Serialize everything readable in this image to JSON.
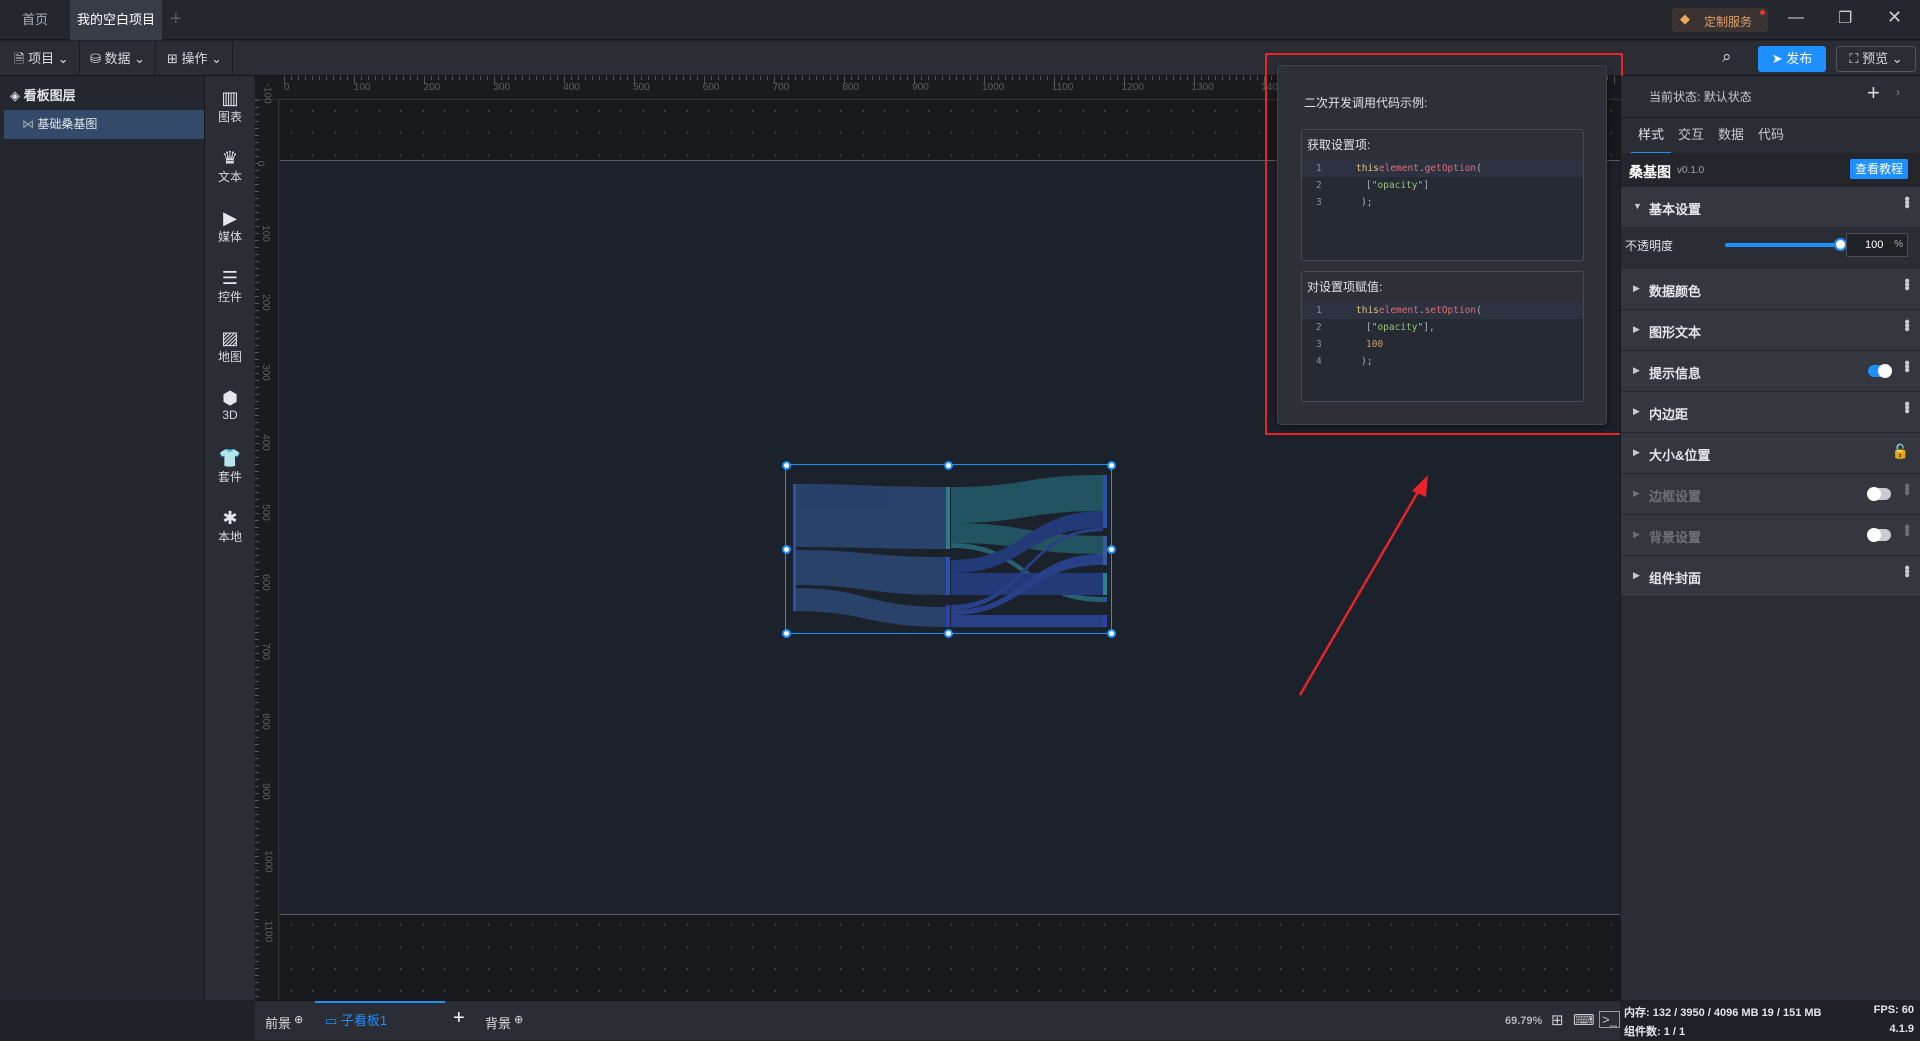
{
  "tabs": [
    {
      "label": "首页"
    },
    {
      "label": "我的空白项目",
      "unsaved": true
    }
  ],
  "titlebar": {
    "service_label": "定制服务"
  },
  "toolbar": {
    "menus": [
      {
        "label": "项目"
      },
      {
        "label": "数据"
      },
      {
        "label": "操作"
      }
    ],
    "publish_label": "发布",
    "preview_label": "预览"
  },
  "layers": {
    "title": "看板图层",
    "items": [
      {
        "label": "基础桑基图"
      }
    ]
  },
  "tools": [
    {
      "label": "图表"
    },
    {
      "label": "文本"
    },
    {
      "label": "媒体"
    },
    {
      "label": "控件"
    },
    {
      "label": "地图"
    },
    {
      "label": "3D"
    },
    {
      "label": "套件"
    },
    {
      "label": "本地"
    }
  ],
  "ruler": {
    "h": [
      "0",
      "100",
      "200",
      "300",
      "400",
      "500",
      "600",
      "700",
      "800",
      "900",
      "1000",
      "1100",
      "1200",
      "1300",
      "1400"
    ],
    "v": [
      "-100",
      "0",
      "100",
      "200",
      "300",
      "400",
      "500",
      "600",
      "700",
      "800",
      "900",
      "1000",
      "1100"
    ]
  },
  "popover": {
    "title": "二次开发调用代码示例:",
    "get_title": "获取设置项:",
    "set_title": "对设置项赋值:",
    "get_code": [
      {
        "n": "1",
        "this": "this",
        ".": ".",
        "el": "element",
        "fn": "getOption",
        "p": "("
      },
      {
        "n": "2",
        "str": "\"opacity\""
      },
      {
        "n": "3",
        "end": ");"
      }
    ],
    "set_code": [
      {
        "n": "1",
        "this": "this",
        ".": ".",
        "el": "element",
        "fn": "setOption",
        "p": "("
      },
      {
        "n": "2",
        "str": "\"opacity\""
      },
      {
        "n": "3",
        "num": "100"
      },
      {
        "n": "4",
        "end": ");"
      }
    ]
  },
  "right": {
    "state_label": "当前状态:",
    "state_value": "默认状态",
    "tabs": [
      {
        "label": "样式"
      },
      {
        "label": "交互"
      },
      {
        "label": "数据"
      },
      {
        "label": "代码"
      }
    ],
    "component": {
      "name": "桑基图",
      "version": "v0.1.0",
      "tutorial_label": "查看教程"
    },
    "basic": {
      "label": "基本设置",
      "opacity_label": "不透明度",
      "opacity_value": "100",
      "opacity_unit": "%",
      "opacity_fraction": 1.0
    },
    "sections": [
      {
        "label": "数据颜色"
      },
      {
        "label": "图形文本"
      },
      {
        "label": "提示信息",
        "toggle": true
      },
      {
        "label": "内边距"
      },
      {
        "label": "大小&位置"
      },
      {
        "label": "边框设置",
        "toggle": false
      },
      {
        "label": "背景设置",
        "toggle": false
      },
      {
        "label": "组件封面"
      }
    ]
  },
  "bottom": {
    "foreground_label": "前景",
    "board_label": "子看板1",
    "background_label": "背景",
    "zoom": "69.79%"
  },
  "status": {
    "memory": "内存: 132 / 3950 / 4096 MB  19 / 151 MB",
    "fps": "FPS: 60",
    "components": "组件数: 1 / 1",
    "version": "4.1.9"
  },
  "colors": {
    "accent": "#1e8fff",
    "annotation": "#e8232a",
    "board": "#1c222b"
  }
}
